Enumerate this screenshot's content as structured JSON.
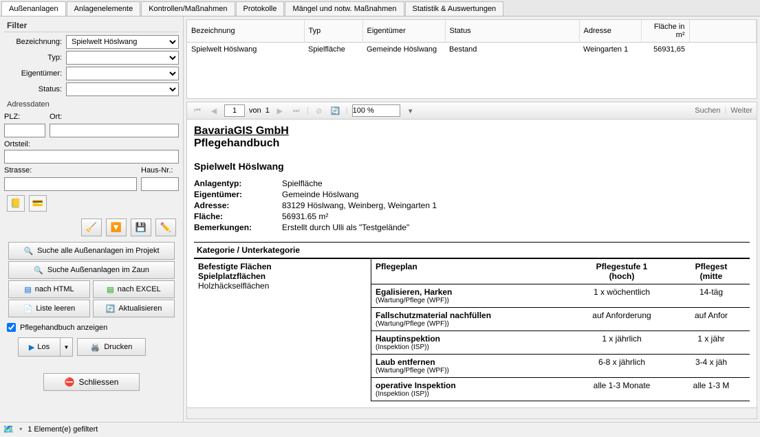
{
  "tabs": [
    "Außenanlagen",
    "Anlagenelemente",
    "Kontrollen/Maßnahmen",
    "Protokolle",
    "Mängel und notw. Maßnahmen",
    "Statistik & Auswertungen"
  ],
  "filter": {
    "title": "Filter",
    "labels": {
      "bez": "Bezeichnung:",
      "typ": "Typ:",
      "eig": "Eigentümer:",
      "status": "Status:"
    },
    "values": {
      "bez": "Spielwelt Höslwang",
      "typ": "",
      "eig": "",
      "status": ""
    },
    "addr_title": "Adressdaten",
    "addr_labels": {
      "plz": "PLZ:",
      "ort": "Ort:",
      "ortsteil": "Ortsteil:",
      "strasse": "Strasse:",
      "hausnr": "Haus-Nr.:"
    }
  },
  "left_btns": {
    "search_project": "Suche alle Außenanlagen im Projekt",
    "search_zaun": "Suche Außenanlagen im Zaun",
    "html": "nach HTML",
    "excel": "nach EXCEL",
    "clear": "Liste leeren",
    "refresh": "Aktualisieren",
    "pflege_chk": "Pflegehandbuch anzeigen",
    "los": "Los",
    "print": "Drucken",
    "close": "Schliessen"
  },
  "grid": {
    "headers": [
      "Bezeichnung",
      "Typ",
      "Eigentümer",
      "Status",
      "Adresse",
      "Fläche in m²"
    ],
    "row": [
      "Spielwelt Höslwang",
      "Spielfläche",
      "Gemeinde Höslwang",
      "Bestand",
      "Weingarten 1",
      "56931,65"
    ]
  },
  "rv": {
    "page": "1",
    "of": "von",
    "total": "1",
    "zoom": "100 %",
    "find": "Suchen",
    "next": "Weiter"
  },
  "report": {
    "company": "BavariaGIS GmbH",
    "title": "Pflegehandbuch",
    "h2": "Spielwelt Höslwang",
    "info": [
      {
        "l": "Anlagentyp:",
        "v": "Spielfläche"
      },
      {
        "l": "Eigentümer:",
        "v": "Gemeinde Höslwang"
      },
      {
        "l": "Adresse:",
        "v": "83129 Höslwang, Weinberg, Weingarten 1"
      },
      {
        "l": "Fläche:",
        "v": "56931.65 m²"
      },
      {
        "l": "Bemerkungen:",
        "v": "Erstellt durch Ulli als \"Testgelände\""
      }
    ],
    "kat_head": "Kategorie / Unterkategorie",
    "left_col": {
      "l1": "Befestigte Flächen",
      "l2": "Spielplatzflächen",
      "l3": "Holzhäckselflächen"
    },
    "right_head": {
      "c1": "Pflegeplan",
      "c2a": "Pflegestufe 1",
      "c2b": "(hoch)",
      "c3a": "Pflegest",
      "c3b": "(mitte"
    },
    "rows": [
      {
        "t": "Egalisieren, Harken",
        "s": "(Wartung/Pflege (WPF))",
        "c2": "1 x wöchentlich",
        "c3": "14-täg"
      },
      {
        "t": "Fallschutzmaterial nachfüllen",
        "s": "(Wartung/Pflege (WPF))",
        "c2": "auf Anforderung",
        "c3": "auf Anfor"
      },
      {
        "t": "Hauptinspektion",
        "s": "(Inspektion (ISP))",
        "c2": "1 x jährlich",
        "c3": "1 x jähr"
      },
      {
        "t": "Laub entfernen",
        "s": "(Wartung/Pflege (WPF))",
        "c2": "6-8 x jährlich",
        "c3": "3-4 x jäh"
      },
      {
        "t": "operative Inspektion",
        "s": "(Inspektion (ISP))",
        "c2": "alle 1-3 Monate",
        "c3": "alle 1-3 M"
      }
    ]
  },
  "footer": "1 Element(e) gefiltert"
}
